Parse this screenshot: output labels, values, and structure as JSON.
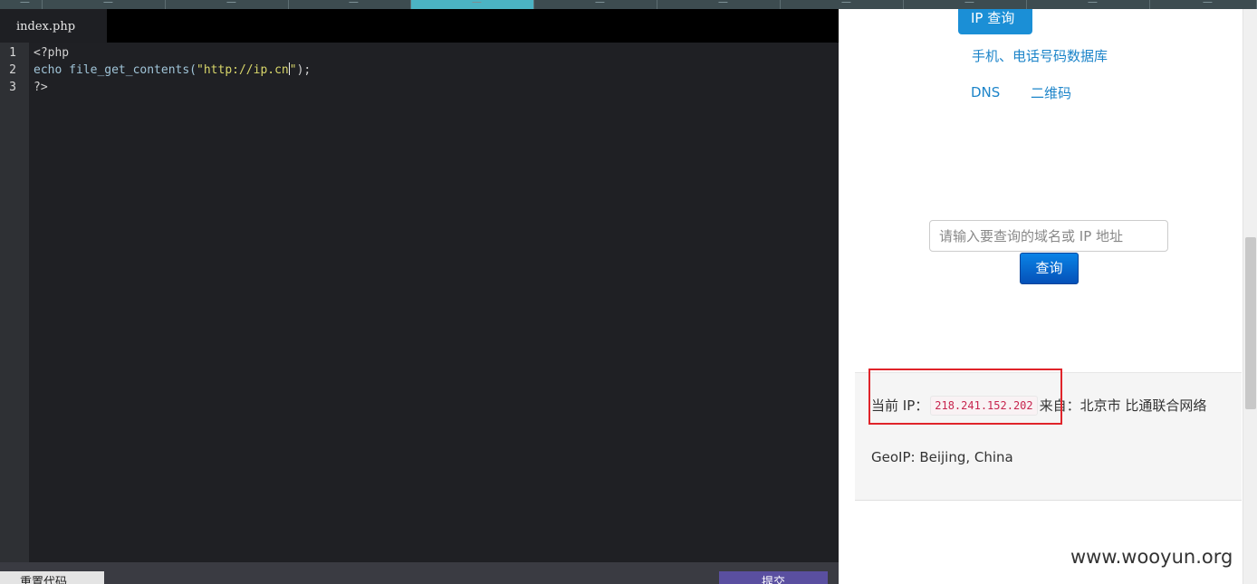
{
  "editor": {
    "tab_label": "index.php",
    "line_numbers": [
      "1",
      "2",
      "3"
    ],
    "code": {
      "line1": "<?php",
      "line2_func": "echo file_get_contents(",
      "line2_str_a": "\"http://ip.cn",
      "line2_str_b": "\"",
      "line2_tail": ");",
      "line3": "?>"
    },
    "reset_label": "重置代码",
    "submit_label": "提交"
  },
  "browser": {
    "nav": {
      "ip_query": "IP 查询",
      "phone_db": "手机、电话号码数据库",
      "dns": "DNS",
      "qrcode": "二维码"
    },
    "search": {
      "placeholder": "请输入要查询的域名或 IP 地址",
      "button": "查询"
    },
    "result": {
      "current_ip_label": "当前 IP：",
      "ip": "218.241.152.202",
      "from_label": "来自：北京市 比通联合网络",
      "geoip": "GeoIP: Beijing, China"
    }
  },
  "watermark": "www.wooyun.org",
  "colors": {
    "accent_blue": "#1b8fd6",
    "highlight_red": "#e0242a",
    "editor_bg": "#1f2024"
  }
}
